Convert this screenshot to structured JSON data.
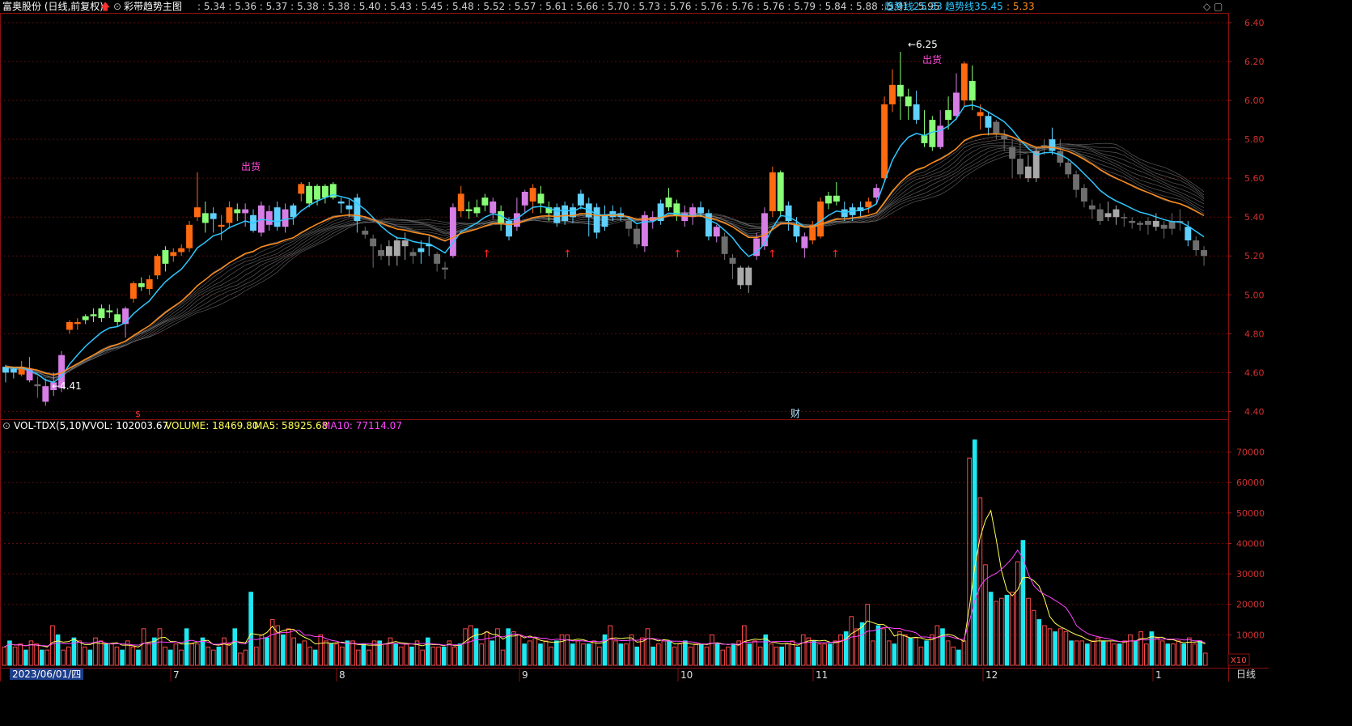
{
  "header": {
    "stock_title": "富奥股份 (日线,前复权)",
    "indicator_name": "彩带趋势主图",
    "price_strip": ": 5.34 : 5.36 : 5.37 : 5.38 : 5.38 : 5.40 : 5.43 : 5.45 : 5.48 : 5.52 : 5.57 : 5.61 : 5.66 : 5.70 : 5.73 : 5.76 : 5.76 : 5.76 : 5.76 : 5.79 : 5.84 : 5.88 : 5.91 : 5.95",
    "trend2_label": "趋势线2:",
    "trend2_value": "5.33",
    "trend3_label": "趋势线3:",
    "trend3_value": "5.45",
    "last_value": ": 5.33",
    "color_trend2": "#2ec7ff",
    "color_trend3": "#ff8c1a"
  },
  "volume_header": {
    "name": "VOL-TDX(5,10)",
    "vvol": "VVOL: 102003.67",
    "volume": "VOLUME: 18469.80",
    "ma5": "MA5: 58925.68",
    "ma10": "MA10: 77114.07",
    "color_volume": "#ffff55",
    "color_ma5": "#ffff55",
    "color_ma10": "#ff44ff"
  },
  "x_axis": {
    "first_label": "2023/06/01/四",
    "month_labels": [
      "7",
      "8",
      "9",
      "10",
      "11",
      "12",
      "1"
    ],
    "period": "日线",
    "scale_tag": "X10"
  },
  "markers": {
    "sell_label": "出货",
    "low_price": "4.41",
    "high_price": "6.25",
    "fin_label": "财",
    "s_label": "$"
  },
  "chart_data": {
    "type": "candlestick",
    "price_axis": {
      "ylim": [
        4.36,
        6.45
      ],
      "ticks": [
        "4.40",
        "4.60",
        "4.80",
        "5.00",
        "5.20",
        "5.40",
        "5.60",
        "5.80",
        "6.00",
        "6.20",
        "6.40"
      ]
    },
    "volume_axis": {
      "ylim": [
        0,
        76000
      ],
      "ticks": [
        "10000",
        "20000",
        "30000",
        "40000",
        "50000",
        "60000",
        "70000"
      ]
    },
    "candles": [
      [
        4.6,
        4.63,
        4.64,
        4.55,
        "b"
      ],
      [
        4.62,
        4.6,
        4.63,
        4.57,
        "b"
      ],
      [
        4.59,
        4.63,
        4.66,
        4.58,
        "o"
      ],
      [
        4.62,
        4.56,
        4.68,
        4.55,
        "p"
      ],
      [
        4.54,
        4.53,
        4.58,
        4.47,
        "d"
      ],
      [
        4.53,
        4.45,
        4.57,
        4.43,
        "p"
      ],
      [
        4.55,
        4.51,
        4.6,
        4.48,
        "p"
      ],
      [
        4.52,
        4.69,
        4.71,
        4.5,
        "p"
      ],
      [
        4.82,
        4.86,
        4.87,
        4.8,
        "o"
      ],
      [
        4.85,
        4.86,
        4.88,
        4.82,
        "o"
      ],
      [
        4.87,
        4.89,
        4.9,
        4.85,
        "g"
      ],
      [
        4.89,
        4.9,
        4.93,
        4.86,
        "g"
      ],
      [
        4.88,
        4.93,
        4.95,
        4.86,
        "g"
      ],
      [
        4.92,
        4.91,
        4.95,
        4.88,
        "g"
      ],
      [
        4.9,
        4.86,
        4.93,
        4.84,
        "g"
      ],
      [
        4.85,
        4.93,
        4.94,
        4.78,
        "p"
      ],
      [
        4.98,
        5.06,
        5.07,
        4.96,
        "o"
      ],
      [
        5.04,
        5.06,
        5.09,
        5.02,
        "g"
      ],
      [
        5.03,
        5.08,
        5.1,
        5.0,
        "o"
      ],
      [
        5.1,
        5.2,
        5.21,
        5.08,
        "o"
      ],
      [
        5.16,
        5.23,
        5.25,
        5.12,
        "g"
      ],
      [
        5.2,
        5.22,
        5.24,
        5.17,
        "o"
      ],
      [
        5.22,
        5.24,
        5.26,
        5.2,
        "o"
      ],
      [
        5.24,
        5.36,
        5.38,
        5.22,
        "o"
      ],
      [
        5.4,
        5.45,
        5.63,
        5.38,
        "o"
      ],
      [
        5.42,
        5.37,
        5.48,
        5.32,
        "g"
      ],
      [
        5.39,
        5.42,
        5.45,
        5.32,
        "b"
      ],
      [
        5.35,
        5.36,
        5.41,
        5.28,
        "o"
      ],
      [
        5.37,
        5.45,
        5.48,
        5.34,
        "o"
      ],
      [
        5.44,
        5.42,
        5.47,
        5.38,
        "g"
      ],
      [
        5.42,
        5.44,
        5.47,
        5.35,
        "p"
      ],
      [
        5.41,
        5.33,
        5.44,
        5.32,
        "b"
      ],
      [
        5.32,
        5.46,
        5.48,
        5.3,
        "p"
      ],
      [
        5.43,
        5.36,
        5.46,
        5.33,
        "p"
      ],
      [
        5.45,
        5.35,
        5.48,
        5.33,
        "b"
      ],
      [
        5.35,
        5.44,
        5.47,
        5.32,
        "p"
      ],
      [
        5.46,
        5.4,
        5.47,
        5.36,
        "b"
      ],
      [
        5.52,
        5.57,
        5.58,
        5.48,
        "o"
      ],
      [
        5.47,
        5.56,
        5.58,
        5.45,
        "g"
      ],
      [
        5.49,
        5.56,
        5.57,
        5.46,
        "g"
      ],
      [
        5.5,
        5.56,
        5.57,
        5.47,
        "g"
      ],
      [
        5.5,
        5.57,
        5.58,
        5.49,
        "g"
      ],
      [
        5.48,
        5.47,
        5.5,
        5.42,
        "b"
      ],
      [
        5.44,
        5.46,
        5.49,
        5.4,
        "b"
      ],
      [
        5.5,
        5.38,
        5.52,
        5.32,
        "b"
      ],
      [
        5.31,
        5.33,
        5.35,
        5.29,
        "d"
      ],
      [
        5.29,
        5.25,
        5.31,
        5.14,
        "d"
      ],
      [
        5.23,
        5.2,
        5.26,
        5.18,
        "d"
      ],
      [
        5.25,
        5.2,
        5.28,
        5.15,
        "L"
      ],
      [
        5.28,
        5.2,
        5.3,
        5.15,
        "L"
      ],
      [
        5.25,
        5.28,
        5.32,
        5.18,
        "L"
      ],
      [
        5.2,
        5.22,
        5.24,
        5.16,
        "d"
      ],
      [
        5.22,
        5.24,
        5.28,
        5.16,
        "b"
      ],
      [
        5.26,
        5.25,
        5.3,
        5.2,
        "b"
      ],
      [
        5.21,
        5.16,
        5.22,
        5.12,
        "d"
      ],
      [
        5.14,
        5.13,
        5.17,
        5.08,
        "d"
      ],
      [
        5.2,
        5.45,
        5.47,
        5.19,
        "p"
      ],
      [
        5.43,
        5.52,
        5.56,
        5.4,
        "o"
      ],
      [
        5.44,
        5.43,
        5.48,
        5.39,
        "g"
      ],
      [
        5.42,
        5.45,
        5.49,
        5.4,
        "g"
      ],
      [
        5.46,
        5.5,
        5.52,
        5.43,
        "g"
      ],
      [
        5.42,
        5.48,
        5.5,
        5.39,
        "p"
      ],
      [
        5.43,
        5.37,
        5.46,
        5.33,
        "g"
      ],
      [
        5.38,
        5.3,
        5.4,
        5.28,
        "b"
      ],
      [
        5.35,
        5.42,
        5.5,
        5.33,
        "p"
      ],
      [
        5.46,
        5.53,
        5.54,
        5.42,
        "p"
      ],
      [
        5.48,
        5.55,
        5.57,
        5.42,
        "o"
      ],
      [
        5.52,
        5.47,
        5.56,
        5.42,
        "g"
      ],
      [
        5.45,
        5.42,
        5.48,
        5.38,
        "g"
      ],
      [
        5.45,
        5.37,
        5.47,
        5.35,
        "b"
      ],
      [
        5.38,
        5.46,
        5.48,
        5.36,
        "b"
      ],
      [
        5.45,
        5.4,
        5.47,
        5.37,
        "b"
      ],
      [
        5.46,
        5.52,
        5.54,
        5.44,
        "b"
      ],
      [
        5.47,
        5.4,
        5.5,
        5.3,
        "b"
      ],
      [
        5.45,
        5.32,
        5.47,
        5.29,
        "b"
      ],
      [
        5.35,
        5.41,
        5.46,
        5.33,
        "b"
      ],
      [
        5.4,
        5.43,
        5.46,
        5.38,
        "b"
      ],
      [
        5.42,
        5.4,
        5.45,
        5.38,
        "b"
      ],
      [
        5.38,
        5.34,
        5.4,
        5.3,
        "d"
      ],
      [
        5.34,
        5.26,
        5.36,
        5.24,
        "d"
      ],
      [
        5.25,
        5.41,
        5.43,
        5.22,
        "p"
      ],
      [
        5.4,
        5.38,
        5.43,
        5.34,
        "p"
      ],
      [
        5.38,
        5.47,
        5.49,
        5.36,
        "b"
      ],
      [
        5.45,
        5.5,
        5.55,
        5.43,
        "g"
      ],
      [
        5.47,
        5.41,
        5.49,
        5.38,
        "g"
      ],
      [
        5.42,
        5.38,
        5.46,
        5.35,
        "p"
      ],
      [
        5.45,
        5.4,
        5.47,
        5.36,
        "p"
      ],
      [
        5.45,
        5.42,
        5.48,
        5.4,
        "b"
      ],
      [
        5.42,
        5.3,
        5.44,
        5.28,
        "b"
      ],
      [
        5.35,
        5.3,
        5.36,
        5.27,
        "p"
      ],
      [
        5.3,
        5.21,
        5.32,
        5.18,
        "d"
      ],
      [
        5.19,
        5.16,
        5.21,
        5.08,
        "d"
      ],
      [
        5.14,
        5.05,
        5.15,
        5.03,
        "L"
      ],
      [
        5.14,
        5.05,
        5.15,
        5.01,
        "L"
      ],
      [
        5.2,
        5.29,
        5.32,
        5.18,
        "p"
      ],
      [
        5.25,
        5.42,
        5.45,
        5.23,
        "p"
      ],
      [
        5.43,
        5.63,
        5.66,
        5.4,
        "o"
      ],
      [
        5.43,
        5.63,
        5.64,
        5.4,
        "g"
      ],
      [
        5.46,
        5.38,
        5.48,
        5.33,
        "b"
      ],
      [
        5.36,
        5.3,
        5.4,
        5.27,
        "b"
      ],
      [
        5.3,
        5.24,
        5.32,
        5.19,
        "p"
      ],
      [
        5.28,
        5.36,
        5.38,
        5.26,
        "o"
      ],
      [
        5.3,
        5.48,
        5.5,
        5.29,
        "o"
      ],
      [
        5.47,
        5.51,
        5.53,
        5.44,
        "g"
      ],
      [
        5.48,
        5.51,
        5.58,
        5.46,
        "g"
      ],
      [
        5.44,
        5.4,
        5.48,
        5.38,
        "b"
      ],
      [
        5.41,
        5.45,
        5.47,
        5.38,
        "b"
      ],
      [
        5.43,
        5.45,
        5.48,
        5.4,
        "b"
      ],
      [
        5.45,
        5.48,
        5.5,
        5.42,
        "o"
      ],
      [
        5.5,
        5.55,
        5.57,
        5.47,
        "p"
      ],
      [
        5.6,
        5.98,
        6.02,
        5.58,
        "o"
      ],
      [
        5.98,
        6.08,
        6.16,
        5.94,
        "o"
      ],
      [
        6.08,
        6.02,
        6.25,
        5.9,
        "g"
      ],
      [
        6.02,
        5.97,
        6.06,
        5.9,
        "g"
      ],
      [
        5.98,
        5.9,
        6.05,
        5.88,
        "b"
      ],
      [
        5.82,
        5.78,
        5.95,
        5.76,
        "g"
      ],
      [
        5.76,
        5.9,
        5.92,
        5.74,
        "g"
      ],
      [
        5.76,
        5.87,
        5.95,
        5.75,
        "p"
      ],
      [
        5.9,
        5.95,
        6.02,
        5.85,
        "g"
      ],
      [
        5.92,
        6.04,
        6.14,
        5.9,
        "p"
      ],
      [
        6.0,
        6.19,
        6.2,
        5.97,
        "o"
      ],
      [
        6.1,
        6.0,
        6.18,
        5.95,
        "g"
      ],
      [
        5.94,
        5.92,
        5.98,
        5.85,
        "o"
      ],
      [
        5.92,
        5.86,
        5.94,
        5.82,
        "b"
      ],
      [
        5.89,
        5.83,
        5.9,
        5.8,
        "d"
      ],
      [
        5.82,
        5.8,
        5.85,
        5.74,
        "d"
      ],
      [
        5.76,
        5.7,
        5.8,
        5.6,
        "d"
      ],
      [
        5.7,
        5.62,
        5.8,
        5.6,
        "d"
      ],
      [
        5.66,
        5.6,
        5.72,
        5.58,
        "L"
      ],
      [
        5.74,
        5.6,
        5.76,
        5.58,
        "L"
      ],
      [
        5.76,
        5.77,
        5.8,
        5.72,
        "d"
      ],
      [
        5.8,
        5.74,
        5.86,
        5.72,
        "b"
      ],
      [
        5.74,
        5.68,
        5.8,
        5.66,
        "d"
      ],
      [
        5.68,
        5.62,
        5.7,
        5.6,
        "d"
      ],
      [
        5.62,
        5.54,
        5.64,
        5.5,
        "d"
      ],
      [
        5.55,
        5.48,
        5.57,
        5.45,
        "d"
      ],
      [
        5.46,
        5.44,
        5.49,
        5.39,
        "d"
      ],
      [
        5.44,
        5.38,
        5.47,
        5.36,
        "d"
      ],
      [
        5.42,
        5.4,
        5.48,
        5.38,
        "L"
      ],
      [
        5.44,
        5.4,
        5.46,
        5.36,
        "L"
      ],
      [
        5.4,
        5.4,
        5.42,
        5.35,
        "d"
      ],
      [
        5.38,
        5.37,
        5.4,
        5.34,
        "d"
      ],
      [
        5.37,
        5.36,
        5.38,
        5.33,
        "d"
      ],
      [
        5.36,
        5.38,
        5.4,
        5.31,
        "d"
      ],
      [
        5.38,
        5.35,
        5.42,
        5.33,
        "L"
      ],
      [
        5.36,
        5.34,
        5.38,
        5.29,
        "d"
      ],
      [
        5.38,
        5.34,
        5.42,
        5.31,
        "d"
      ],
      [
        5.38,
        5.37,
        5.44,
        5.33,
        "d"
      ],
      [
        5.35,
        5.28,
        5.38,
        5.25,
        "b"
      ],
      [
        5.28,
        5.23,
        5.3,
        5.2,
        "d"
      ],
      [
        5.23,
        5.2,
        5.25,
        5.15,
        "d"
      ]
    ],
    "volumes": [
      6,
      8,
      6,
      7,
      5,
      8,
      7,
      5,
      5,
      13,
      10,
      5,
      6,
      9,
      8,
      6,
      5,
      9,
      8,
      7,
      7,
      6,
      5,
      8,
      6,
      5,
      12,
      7,
      9,
      12,
      6,
      5,
      7,
      5,
      12,
      7,
      7,
      9,
      6,
      5,
      6,
      9,
      7,
      12,
      4,
      5,
      24,
      6,
      10,
      9,
      15,
      13,
      10,
      12,
      9,
      7,
      8,
      6,
      5,
      10,
      8,
      7,
      7,
      6,
      8,
      8,
      5,
      7,
      5,
      8,
      8,
      7,
      9,
      7,
      6,
      7,
      6,
      8,
      5,
      9,
      6,
      6,
      6,
      8,
      6,
      7,
      12,
      13,
      12,
      7,
      11,
      8,
      12,
      5,
      12,
      11,
      10,
      7,
      8,
      9,
      7,
      8,
      6,
      8,
      10,
      10,
      7,
      8,
      7,
      7,
      8,
      6,
      10,
      13,
      8,
      7,
      7,
      10,
      6,
      9,
      12,
      6,
      7,
      8,
      8,
      6,
      7,
      8,
      6,
      7,
      7,
      6,
      10,
      7,
      5,
      6,
      7,
      8,
      13,
      7,
      8,
      6,
      10,
      7,
      6,
      6,
      7,
      8,
      6,
      10,
      9,
      8,
      7,
      7,
      7,
      8,
      10,
      11,
      16,
      12,
      14,
      20,
      8,
      13,
      12,
      8,
      7,
      11,
      10,
      9,
      9,
      6,
      8,
      10,
      13,
      12,
      8,
      6,
      5,
      8,
      68,
      74,
      55,
      33,
      24,
      21,
      22,
      23,
      24,
      34,
      41,
      22,
      18,
      15,
      13,
      12,
      11,
      12,
      11,
      8,
      8,
      8,
      7,
      8,
      9,
      8,
      8,
      7,
      7,
      8,
      10,
      8,
      11,
      7,
      11,
      9,
      8,
      7,
      7,
      8,
      7,
      9,
      7,
      8,
      4
    ]
  }
}
